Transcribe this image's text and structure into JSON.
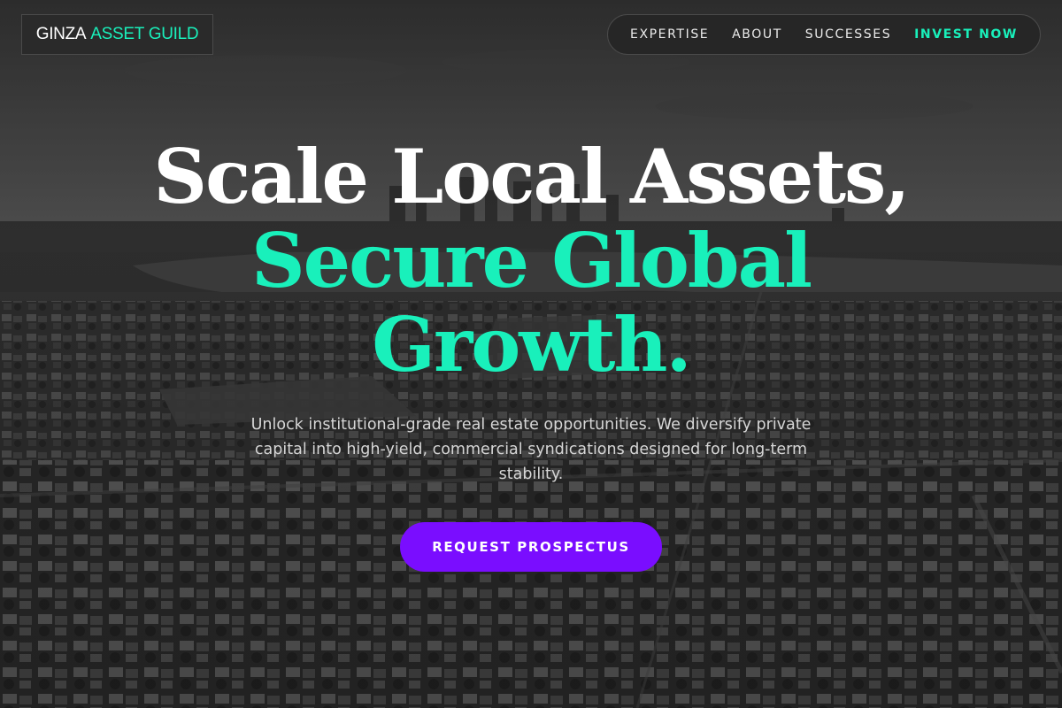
{
  "brand": {
    "name_part1": "GINZA",
    "name_part2": "ASSET GUILD",
    "accent_color": "#19f0bb"
  },
  "nav": {
    "items": [
      {
        "label": "EXPERTISE"
      },
      {
        "label": "ABOUT"
      },
      {
        "label": "SUCCESSES"
      },
      {
        "label": "INVEST NOW"
      }
    ]
  },
  "hero": {
    "line1": "Scale Local Assets,",
    "line2": "Secure Global",
    "line3": "Growth.",
    "subtitle": "Unlock institutional-grade real estate opportunities. We diversify private capital into high-yield, commercial syndications designed for long-term stability.",
    "cta_label": "REQUEST PROSPECTUS",
    "cta_color": "#7a0dff"
  },
  "background": {
    "description_icon": "aerial-city-photo"
  }
}
